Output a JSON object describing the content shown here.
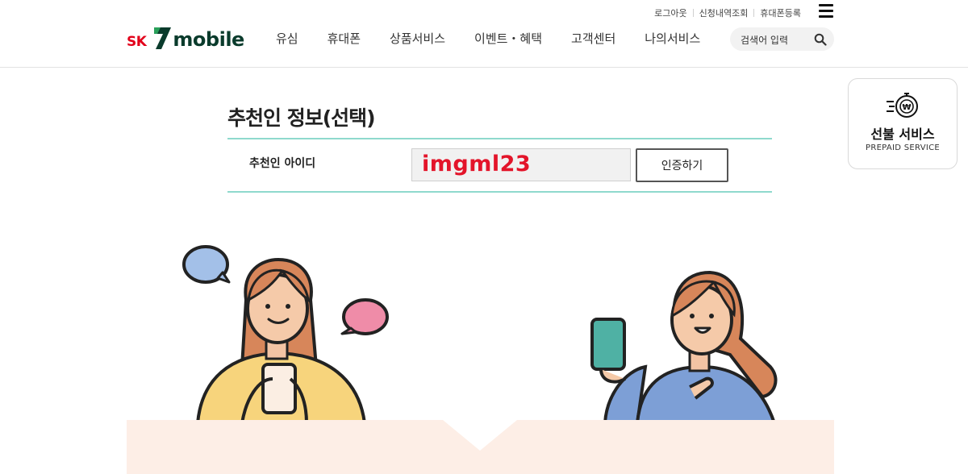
{
  "header": {
    "util_links": [
      "로그아웃",
      "신청내역조회",
      "휴대폰등록"
    ],
    "logo": {
      "sk": "SK",
      "mobile": "mobile"
    },
    "nav": [
      "유심",
      "휴대폰",
      "상품서비스",
      "이벤트・혜택",
      "고객센터",
      "나의서비스"
    ],
    "search": {
      "placeholder": "검색어 입력"
    }
  },
  "prepaid": {
    "title": "선불 서비스",
    "subtitle": "PREPAID SERVICE"
  },
  "recommender": {
    "title": "추천인 정보(선택)",
    "label": "추천인 아이디",
    "value": "imgml23",
    "verify_button": "인증하기"
  },
  "colors": {
    "brand_red": "#e2001a",
    "brand_green": "#0a3b2c",
    "accent_line": "#8fd9cd",
    "panel": "#fdeee6"
  }
}
